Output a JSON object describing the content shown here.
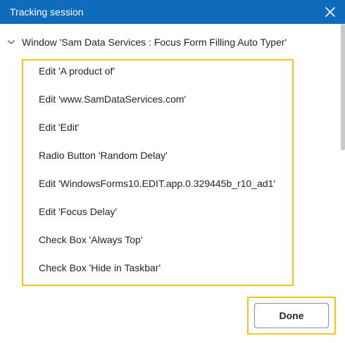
{
  "window": {
    "title": "Tracking session",
    "titlebar_color": "#0f6cbd",
    "highlight_color": "#f5c518"
  },
  "tree": {
    "root_label": "Window 'Sam Data Services : Focus Form Filling Auto Typer'",
    "items": [
      "Edit 'A product of'",
      "Edit 'www.SamDataServices.com'",
      "Edit 'Edit'",
      "Radio Button 'Random Delay'",
      "Edit 'WindowsForms10.EDIT.app.0.329445b_r10_ad1'",
      "Edit 'Focus Delay'",
      "Check Box 'Always Top'",
      "Check Box 'Hide in Taskbar'"
    ]
  },
  "footer": {
    "done_label": "Done"
  }
}
